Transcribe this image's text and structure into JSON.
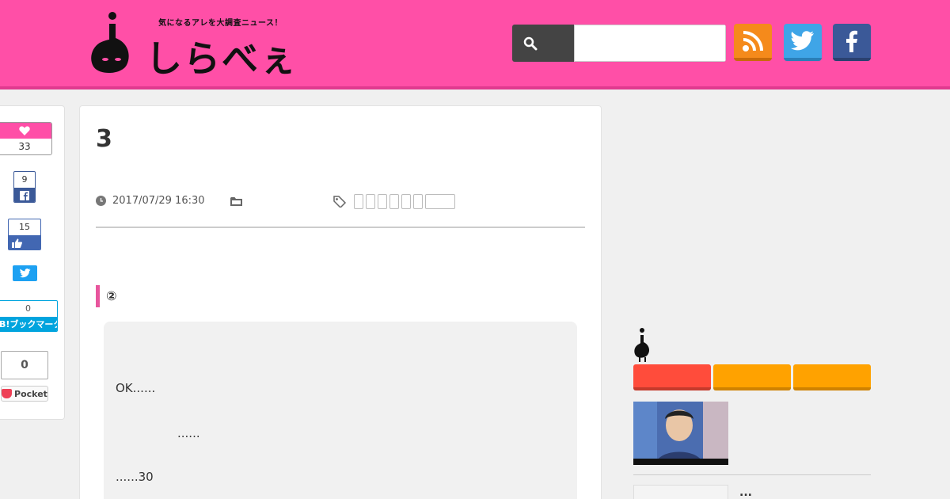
{
  "header": {
    "tagline": "気になるアレを大調査ニュース！",
    "logo_text": "しらべぇ",
    "search_placeholder": ""
  },
  "share": {
    "like_count": "33",
    "facebook_share_count": "9",
    "facebook_like_count": "15",
    "hatena_count": "0",
    "hatena_label": "B!ブックマーク",
    "pocket_count": "0",
    "pocket_label": "Pocket"
  },
  "article": {
    "title": "3",
    "date": "2017/07/29 16:30",
    "section_heading": "②",
    "quote_lines": [
      "OK......",
      "......",
      "......30"
    ]
  },
  "sidebar": {
    "item2_text": "..."
  },
  "colors": {
    "header": "#ff4fa7",
    "accent": "#e8559d",
    "tab_red": "#ff4c3b",
    "tab_orange": "#ffa200"
  }
}
